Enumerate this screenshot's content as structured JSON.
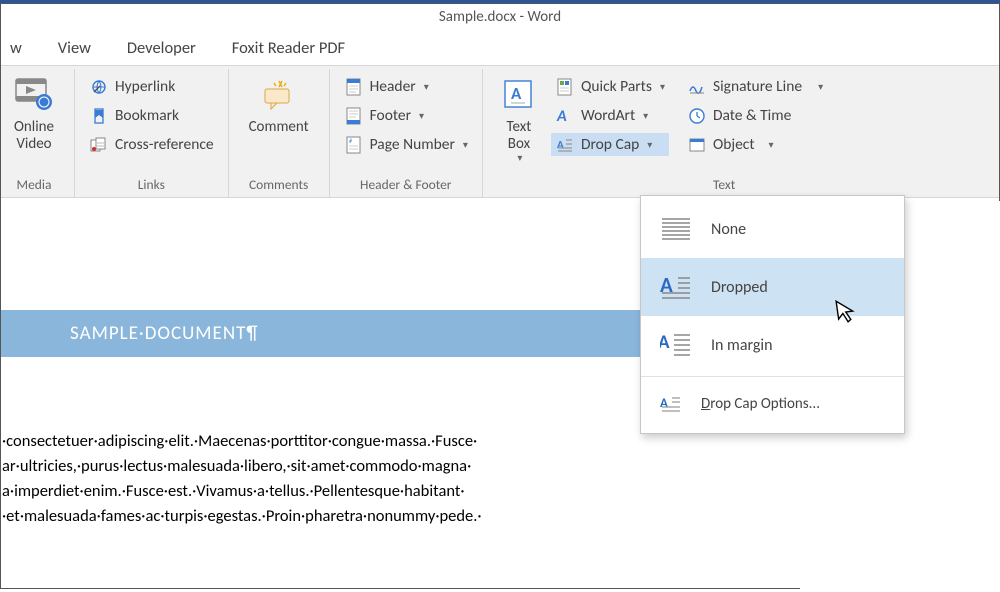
{
  "title": "Sample.docx - Word",
  "tabs": {
    "t0": "w",
    "t1": "View",
    "t2": "Developer",
    "t3": "Foxit Reader PDF"
  },
  "ribbon": {
    "media": {
      "label": "Media",
      "online_video": "Online\nVideo"
    },
    "links": {
      "label": "Links",
      "hyperlink": "Hyperlink",
      "bookmark": "Bookmark",
      "crossref": "Cross-reference"
    },
    "comments": {
      "label": "Comments",
      "comment": "Comment"
    },
    "hf": {
      "label": "Header & Footer",
      "header": "Header",
      "footer": "Footer",
      "pagenum": "Page Number"
    },
    "text": {
      "label": "Text",
      "textbox": "Text\nBox",
      "quickparts": "Quick Parts",
      "wordart": "WordArt",
      "dropcap": "Drop Cap",
      "sigline": "Signature Line",
      "datetime": "Date & Time",
      "object": "Object"
    }
  },
  "dropdown": {
    "none": "None",
    "dropped": "Dropped",
    "inmargin": "In margin",
    "options_pre": "D",
    "options_post": "rop Cap Options..."
  },
  "doc": {
    "heading": "SAMPLE·DOCUMENT¶",
    "body": "·consectetuer·adipiscing·elit.·Maecenas·porttitor·congue·massa.·Fusce·\nar·ultricies,·purus·lectus·malesuada·libero,·sit·amet·commodo·magna·\na·imperdiet·enim.·Fusce·est.·Vivamus·a·tellus.·Pellentesque·habitant·\n·et·malesuada·fames·ac·turpis·egestas.·Proin·pharetra·nonummy·pede.·"
  }
}
